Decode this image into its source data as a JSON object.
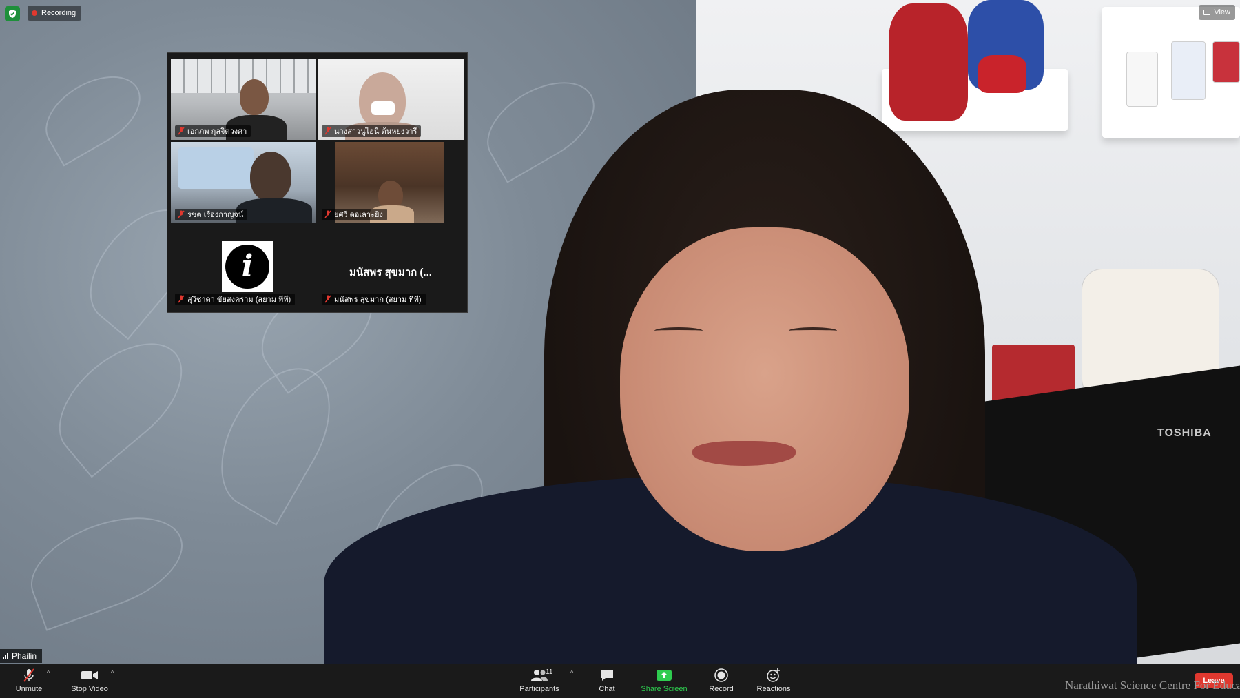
{
  "top_bar": {
    "shield_icon": "shield-check-icon",
    "recording_label": "Recording",
    "view_label": "View"
  },
  "gallery": {
    "tiles": [
      {
        "name": "เอกภพ กุลจิตวงศา",
        "muted": true
      },
      {
        "name": "นางสาวนูไฮนี ต้นหยงวารี",
        "muted": true
      },
      {
        "name": "รชต เรืองกาญจน์",
        "muted": true
      },
      {
        "name": "ยศวี ดอเลาะยิง",
        "muted": true
      },
      {
        "name": "สุวิชาดา ขัยสงคราม (สยาม ทีที)",
        "muted": true,
        "avatar_icon": "info-icon"
      },
      {
        "name": "มนัสพร สุขมาก (สยาม ทีที)",
        "muted": true,
        "display_name": "มนัสพร สุขมาก (..."
      }
    ]
  },
  "active_speaker": {
    "name": "Phailin"
  },
  "background": {
    "tv_brand": "TOSHIBA"
  },
  "toolbar": {
    "unmute_label": "Unmute",
    "stop_video_label": "Stop Video",
    "participants_label": "Participants",
    "participants_count": "11",
    "chat_label": "Chat",
    "share_screen_label": "Share Screen",
    "record_label": "Record",
    "reactions_label": "Reactions",
    "leave_label": "Leave"
  },
  "watermark": "Narathiwat Science Centre For Education",
  "colors": {
    "toolbar_bg": "#1a1a1a",
    "share_green": "#2ecc4f",
    "leave_red": "#e0382f",
    "shield_green": "#1e8f3a"
  }
}
